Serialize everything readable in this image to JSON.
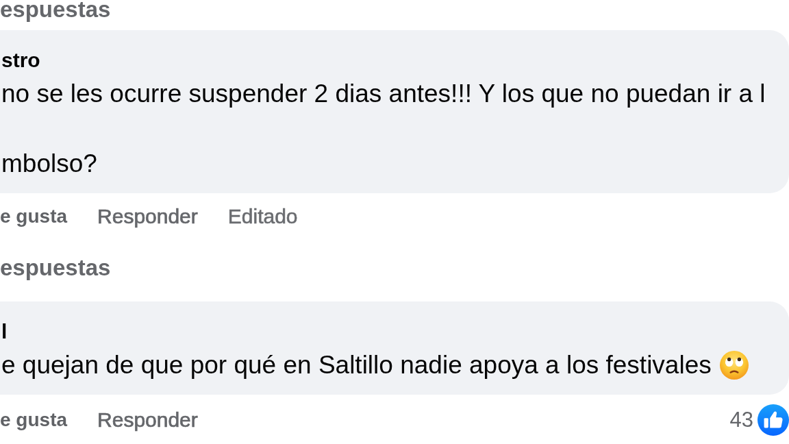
{
  "replies_link_above": "espuestas",
  "comments": [
    {
      "author": "stro",
      "paragraphs": [
        "no se les ocurre suspender 2 dias antes!!! Y los que no puedan ir a l",
        "mbolso?"
      ],
      "ends_with_emoji": false,
      "actions": [
        {
          "kind": "like",
          "label": "e gusta"
        },
        {
          "kind": "reply",
          "label": "Responder"
        },
        {
          "kind": "edited",
          "label": "Editado"
        }
      ],
      "replies_link": "espuestas"
    },
    {
      "author": "l",
      "paragraphs": [
        "e quejan de que por qué en Saltillo nadie apoya a los festivales"
      ],
      "ends_with_emoji": true,
      "actions": [
        {
          "kind": "like",
          "label": "e gusta"
        },
        {
          "kind": "reply",
          "label": "Responder"
        }
      ],
      "reaction_count": "43"
    }
  ]
}
